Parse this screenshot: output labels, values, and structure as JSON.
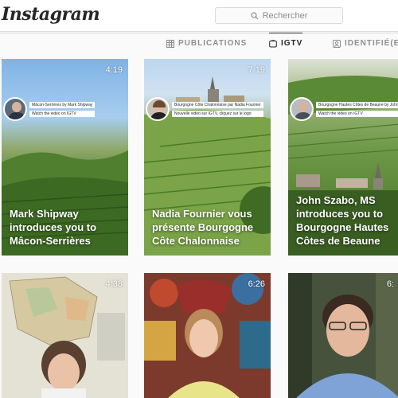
{
  "header": {
    "logo_text": "Instagram",
    "search_placeholder": "Rechercher"
  },
  "tabs": [
    {
      "label": "PUBLICATIONS",
      "icon": "grid-icon",
      "active": false
    },
    {
      "label": "IGTV",
      "icon": "igtv-icon",
      "active": true
    },
    {
      "label": "IDENTIFIÉ(E)",
      "icon": "tagged-icon",
      "active": false
    }
  ],
  "videos": [
    {
      "duration": "4:19",
      "title": "Mark Shipway introduces you to Mâcon-Serrières",
      "overlay_line1": "Mâcon-Serrières by Mark Shipway",
      "overlay_line2": "Watch the video on IGTV"
    },
    {
      "duration": "7:19",
      "title": "Nadia Fournier vous présente Bourgogne Côte Chalonnaise",
      "overlay_line1": "Bourgogne Côte Chalonnaise par Nadia Fournier",
      "overlay_line2": "Nouvelle vidéo sur IGTV, cliquez sur le logo"
    },
    {
      "duration": "",
      "title": "John Szabo, MS introduces you to Bourgogne Hautes Côtes de Beaune",
      "overlay_line1": "Bourgogne Hautes Côtes de Beaune by John Szabo",
      "overlay_line2": "Watch the video on IGTV"
    },
    {
      "duration": "4:38"
    },
    {
      "duration": "6:26"
    },
    {
      "duration": "6:"
    }
  ],
  "colors": {
    "border": "#dbdbdb",
    "muted_text": "#8e8e8e",
    "dark_text": "#262626"
  }
}
